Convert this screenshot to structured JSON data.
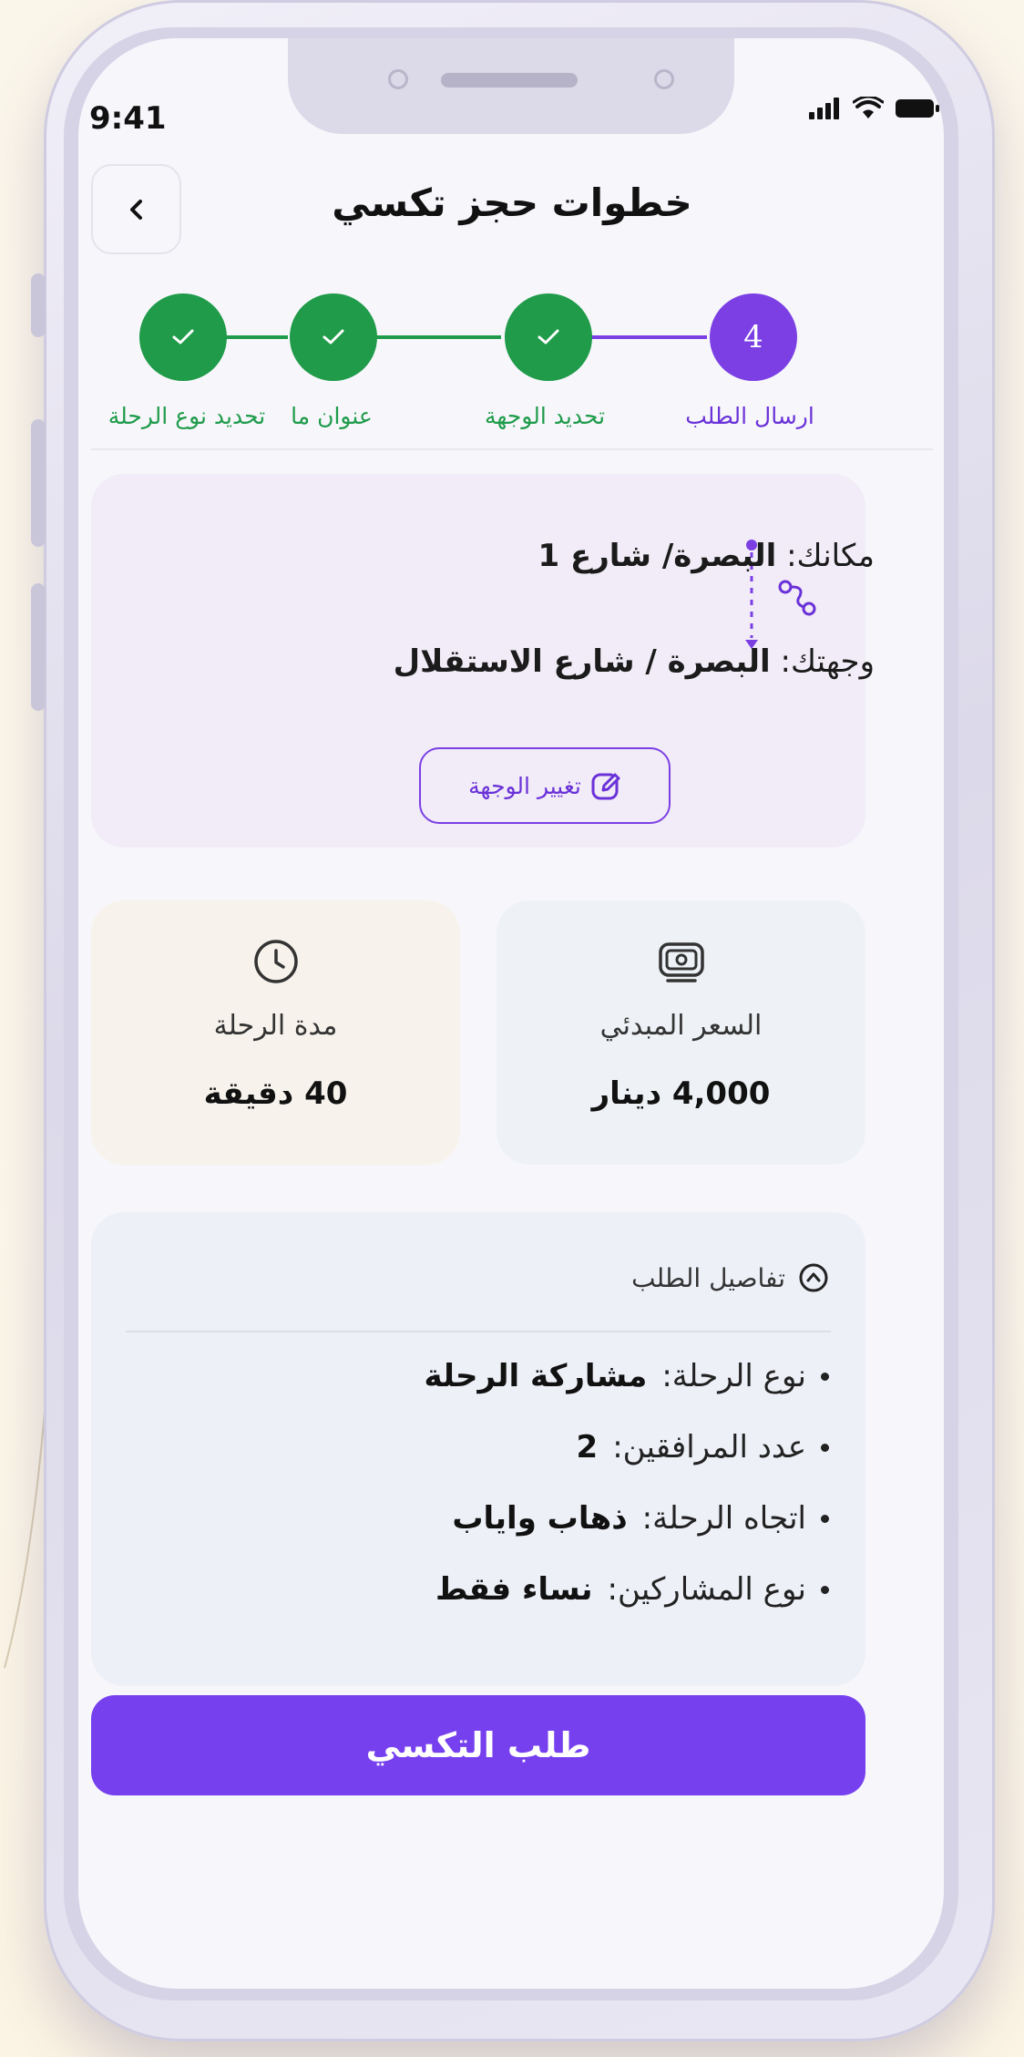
{
  "status_bar": {
    "time": "9:41"
  },
  "header": {
    "title": "خطوات حجز تكسي"
  },
  "stepper": {
    "steps": [
      {
        "label": "ارسال الطلب",
        "number": "4",
        "state": "current"
      },
      {
        "label": "تحديد الوجهة",
        "state": "done"
      },
      {
        "label": "عنوان ما",
        "state": "done"
      },
      {
        "label": "تحديد نوع الرحلة",
        "state": "done"
      }
    ],
    "colors": {
      "done": "#1f9b4a",
      "current": "#7b3fe4"
    }
  },
  "route": {
    "origin_label": "مكانك:",
    "origin_value": "البصرة/ شارع 1",
    "destination_label": "وجهتك:",
    "destination_value": "البصرة / شارع الاستقلال",
    "change_button": "تغيير الوجهة"
  },
  "info": {
    "price": {
      "label": "السعر المبدئي",
      "value": "4,000 دينار",
      "icon": "money-icon"
    },
    "duration": {
      "label": "مدة الرحلة",
      "value": "40 دقيقة",
      "icon": "clock-icon"
    }
  },
  "details": {
    "title": "تفاصيل الطلب",
    "items": [
      {
        "label": "نوع الرحلة:",
        "value": "مشاركة الرحلة"
      },
      {
        "label": "عدد المرافقين:",
        "value": "2"
      },
      {
        "label": "اتجاه الرحلة:",
        "value": "ذهاب واياب"
      },
      {
        "label": "نوع المشاركين:",
        "value": "نساء فقط"
      }
    ]
  },
  "primary_action": {
    "label": "طلب التكسي"
  },
  "colors": {
    "accent": "#7640ee",
    "success": "#1f9b4a"
  }
}
